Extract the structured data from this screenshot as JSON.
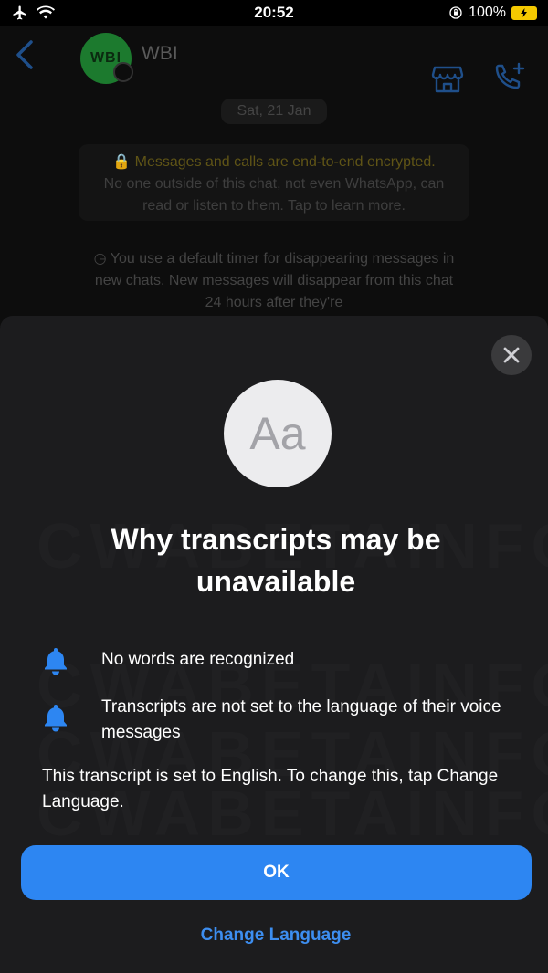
{
  "status_bar": {
    "time": "20:52",
    "battery_percent": "100%",
    "icons": [
      "airplane-icon",
      "wifi-icon",
      "orientation-lock-icon",
      "battery-charging-icon"
    ]
  },
  "chat": {
    "contact_name": "WBI",
    "avatar_initials": "WBI",
    "date": "Sat, 21 Jan",
    "encryption_notice_line1": "Messages and calls are end-to-end encrypted.",
    "encryption_notice_rest": "No one outside of this chat, not even WhatsApp, can read or listen to them. Tap to learn more.",
    "timer_notice": "You use a default timer for disappearing messages in new chats. New messages will disappear from this chat 24 hours after they're"
  },
  "sheet": {
    "icon_text": "Aa",
    "title": "Why transcripts may be unavailable",
    "reasons": [
      {
        "icon": "bell-icon",
        "text": "No words are recognized"
      },
      {
        "icon": "bell-icon",
        "text": "Transcripts are not set to the language of their voice messages"
      }
    ],
    "info": "This transcript is set to English. To change this, tap Change Language.",
    "ok_label": "OK",
    "change_language_label": "Change Language"
  },
  "colors": {
    "sheet_background": "#1c1c1e",
    "primary_button": "#2d86f2",
    "link": "#3d8ef0",
    "icon_blue": "#2d86f2",
    "battery": "#f4c900"
  }
}
